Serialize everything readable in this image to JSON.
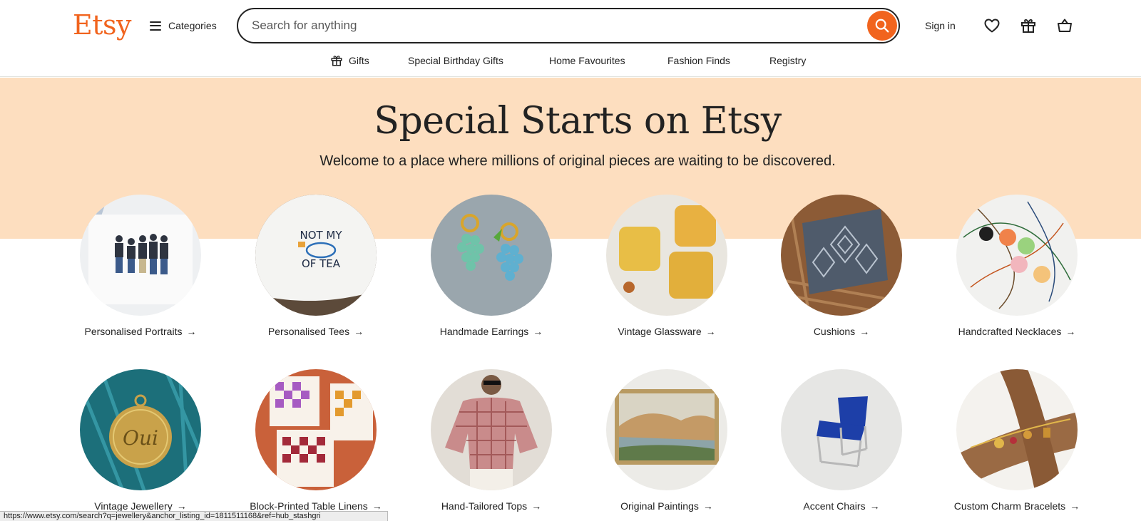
{
  "header": {
    "logo": "Etsy",
    "categories_label": "Categories",
    "search_placeholder": "Search for anything",
    "sign_in": "Sign in"
  },
  "subnav": [
    {
      "label": "Gifts",
      "icon": "gift-icon"
    },
    {
      "label": "Special Birthday Gifts"
    },
    {
      "label": "Home Favourites"
    },
    {
      "label": "Fashion Finds"
    },
    {
      "label": "Registry"
    }
  ],
  "hero": {
    "title": "Special Starts on Etsy",
    "subtitle": "Welcome to a place where millions of original pieces are waiting to be discovered."
  },
  "categories": [
    {
      "label": "Personalised Portraits",
      "arrow": "→"
    },
    {
      "label": "Personalised Tees",
      "arrow": "→"
    },
    {
      "label": "Handmade Earrings",
      "arrow": "→"
    },
    {
      "label": "Vintage Glassware",
      "arrow": "→"
    },
    {
      "label": "Cushions",
      "arrow": "→"
    },
    {
      "label": "Handcrafted Necklaces",
      "arrow": "→"
    },
    {
      "label": "Vintage Jewellery",
      "arrow": "→"
    },
    {
      "label": "Block-Printed Table Linens",
      "arrow": "→"
    },
    {
      "label": "Hand-Tailored Tops",
      "arrow": "→"
    },
    {
      "label": "Original Paintings",
      "arrow": "→"
    },
    {
      "label": "Accent Chairs",
      "arrow": "→"
    },
    {
      "label": "Custom Charm Bracelets",
      "arrow": "→"
    }
  ],
  "status_url": "https://www.etsy.com/search?q=jewellery&anchor_listing_id=1811511168&ref=hub_stashgri",
  "colors": {
    "brand": "#f1641e",
    "hero_bg": "#fddebf",
    "text": "#222222"
  }
}
